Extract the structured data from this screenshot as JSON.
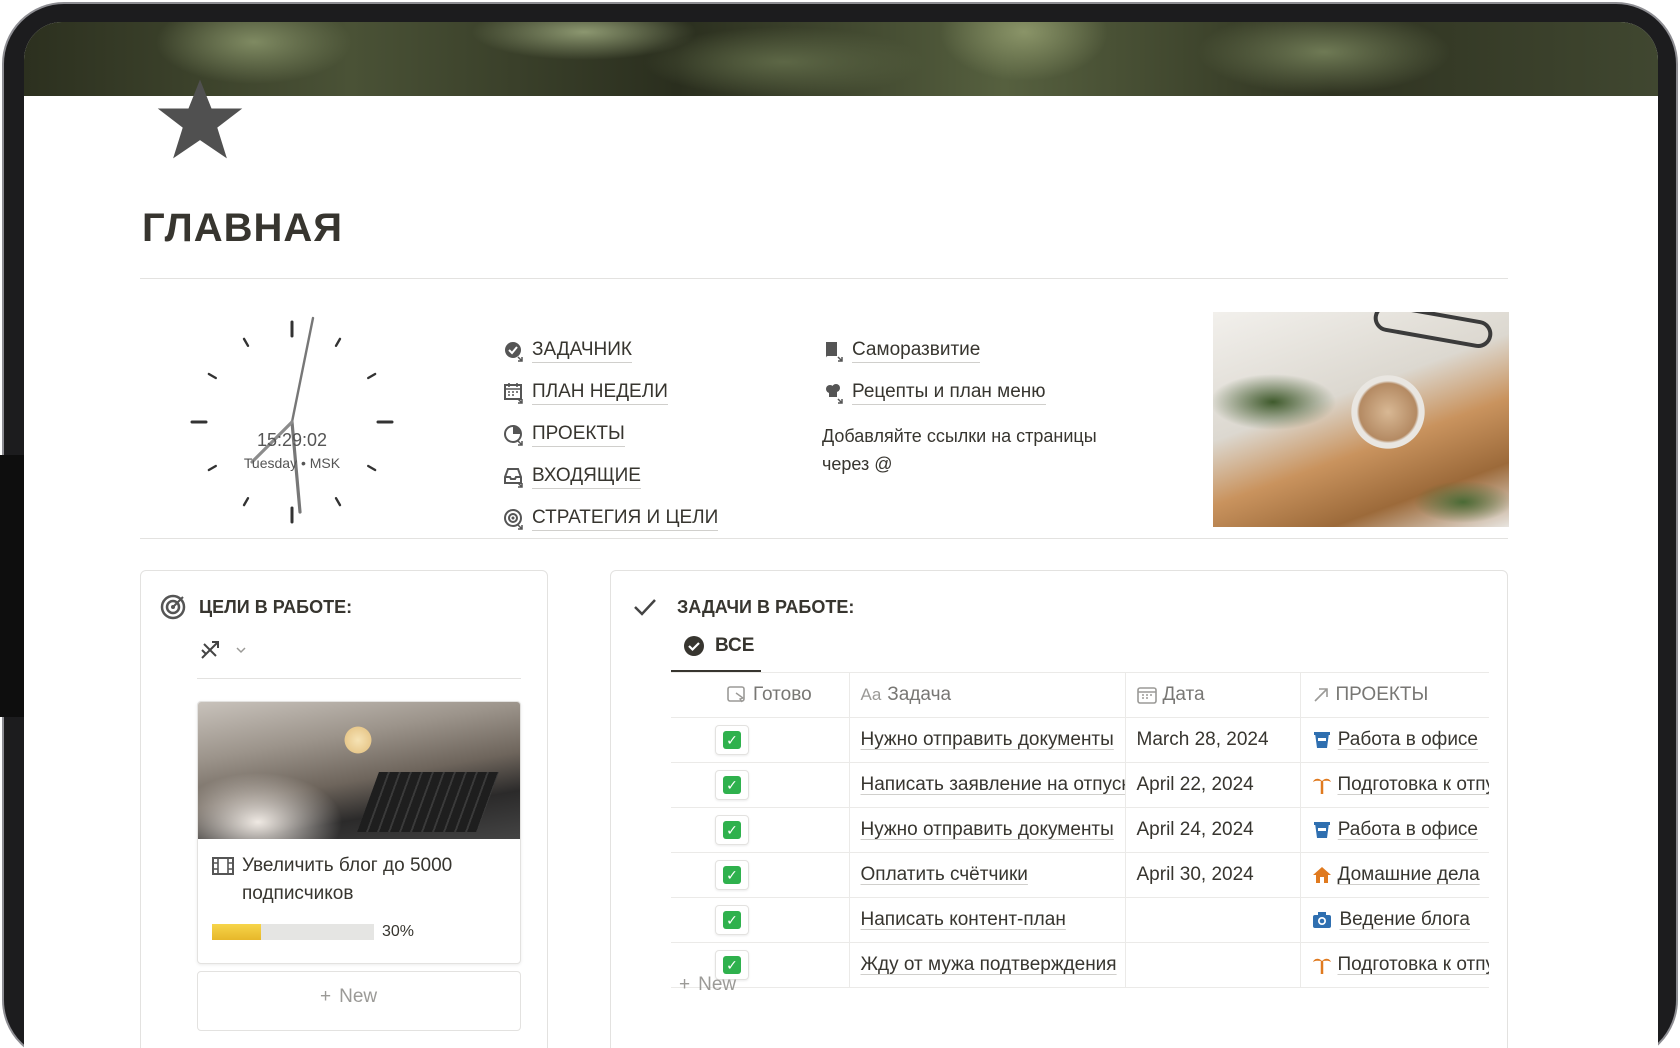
{
  "page": {
    "title": "ГЛАВНАЯ"
  },
  "clock": {
    "time": "15:29:02",
    "day": "Tuesday • MSK"
  },
  "links_left": [
    {
      "label": "ЗАДАЧНИК",
      "icon": "check-badge-icon"
    },
    {
      "label": "ПЛАН НЕДЕЛИ",
      "icon": "calendar-icon"
    },
    {
      "label": "ПРОЕКТЫ",
      "icon": "pie-chart-icon"
    },
    {
      "label": "ВХОДЯЩИЕ",
      "icon": "inbox-icon"
    },
    {
      "label": "СТРАТЕГИЯ И ЦЕЛИ",
      "icon": "target-icon"
    }
  ],
  "links_right": [
    {
      "label": "Саморазвитие",
      "icon": "book-icon"
    },
    {
      "label": "Рецепты и план меню",
      "icon": "chef-icon"
    }
  ],
  "links_hint": "Добавляйте ссылки на страницы через @",
  "goals": {
    "title": "ЦЕЛИ В РАБОТЕ:",
    "card": {
      "name": "Увеличить блог до 5000 подписчиков",
      "progress": 0.3,
      "progress_label": "30%"
    },
    "new_label": "New"
  },
  "tasks": {
    "title": "ЗАДАЧИ В РАБОТЕ:",
    "tab": "ВСЕ",
    "columns": {
      "done": "Готово",
      "task": "Задача",
      "task_prefix": "Aa",
      "date": "Дата",
      "projects": "ПРОЕКТЫ"
    },
    "rows": [
      {
        "task": "Нужно отправить документы",
        "date": "March 28, 2024",
        "project": "Работа в офисе",
        "project_color": "#2f6fb0"
      },
      {
        "task": "Написать заявление на отпуск",
        "date": "April 22, 2024",
        "project": "Подготовка к отпуску",
        "project_color": "#e07a1f"
      },
      {
        "task": "Нужно отправить документы",
        "date": "April 24, 2024",
        "project": "Работа в офисе",
        "project_color": "#2f6fb0"
      },
      {
        "task": "Оплатить счётчики",
        "date": "April 30, 2024",
        "project": "Домашние дела",
        "project_color": "#e07a1f"
      },
      {
        "task": "Написать контент-план",
        "date": "",
        "project": "Ведение блога",
        "project_color": "#2f6fb0"
      },
      {
        "task": "Жду от мужа подтверждения",
        "date": "",
        "project": "Подготовка к отпуску",
        "project_color": "#e07a1f"
      }
    ],
    "new_label": "New"
  }
}
